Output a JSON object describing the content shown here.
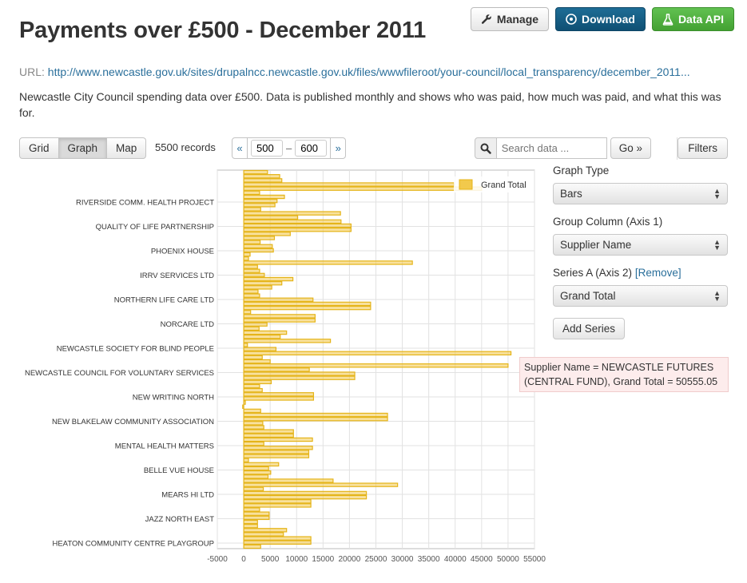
{
  "page": {
    "title": "Payments over £500 - December 2011",
    "url_label": "URL:",
    "url": "http://www.newcastle.gov.uk/sites/drupalncc.newcastle.gov.uk/files/wwwfileroot/your-council/local_transparency/december_2011...",
    "description": "Newcastle City Council spending data over £500. Data is published monthly and shows who was paid, how much was paid, and what this was for."
  },
  "actions": {
    "manage": "Manage",
    "download": "Download",
    "data_api": "Data API"
  },
  "toolbar": {
    "views": [
      "Grid",
      "Graph",
      "Map"
    ],
    "active_view": "Graph",
    "records": "5500 records",
    "prev": "«",
    "next": "»",
    "range_from": "500",
    "range_to": "600",
    "range_sep": "–",
    "search_placeholder": "Search data ...",
    "go": "Go »",
    "filters": "Filters"
  },
  "side": {
    "graph_type_label": "Graph Type",
    "graph_type_value": "Bars",
    "group_column_label": "Group Column (Axis 1)",
    "group_column_value": "Supplier Name",
    "series_a_label": "Series A (Axis 2)",
    "remove_link": "[Remove]",
    "series_a_value": "Grand Total",
    "add_series": "Add Series"
  },
  "tooltip": {
    "text": "Supplier Name = NEWCASTLE FUTURES (CENTRAL FUND), Grand Total = 50555.05"
  },
  "colors": {
    "bar_fill": "#f2c94c",
    "bar_stroke": "#e5b419",
    "primary": "#155e87",
    "success": "#4fb33d",
    "link": "#2a6f9b",
    "tooltip_bg": "#fdecec"
  },
  "chart_data": {
    "type": "bar",
    "orientation": "horizontal",
    "legend": [
      "Grand Total"
    ],
    "legend_position": "top-right",
    "grid": true,
    "xlim": [
      -5000,
      55000
    ],
    "xticks": [
      -5000,
      0,
      5000,
      10000,
      15000,
      20000,
      25000,
      30000,
      35000,
      40000,
      45000,
      50000,
      55000
    ],
    "category_labels": [
      "RIVERSIDE COMM. HEALTH PROJECT",
      "QUALITY OF LIFE PARTNERSHIP",
      "PHOENIX HOUSE",
      "IRRV SERVICES LTD",
      "NORTHERN LIFE CARE LTD",
      "NORCARE LTD",
      "NEWCASTLE SOCIETY FOR BLIND PEOPLE",
      "NEWCASTLE COUNCIL FOR VOLUNTARY SERVICES",
      "NEW WRITING NORTH",
      "NEW BLAKELAW COMMUNITY ASSOCIATION",
      "MENTAL HEALTH MATTERS",
      "BELLE VUE HOUSE",
      "MEARS HI LTD",
      "JAZZ NORTH EAST",
      "HEATON COMMUNITY CENTRE PLAYGROUP"
    ],
    "series": [
      {
        "name": "Grand Total",
        "values": [
          4500,
          6800,
          7200,
          39800,
          45000,
          3000,
          7700,
          6300,
          5900,
          3200,
          18300,
          10200,
          18400,
          20300,
          20300,
          8800,
          5800,
          3100,
          5400,
          5600,
          1200,
          900,
          31900,
          2600,
          3000,
          3900,
          9300,
          7200,
          5300,
          2700,
          3000,
          13100,
          24000,
          24000,
          1300,
          13500,
          13500,
          4400,
          2900,
          8100,
          6900,
          16400,
          700,
          6100,
          50555,
          3500,
          5000,
          50000,
          12400,
          21000,
          21000,
          5200,
          3000,
          3500,
          13200,
          13200,
          300,
          -200,
          3200,
          27200,
          27200,
          3600,
          3800,
          9400,
          9400,
          13000,
          3800,
          13000,
          12300,
          12300,
          900,
          6600,
          4700,
          5100,
          4600,
          16900,
          29100,
          3700,
          23200,
          23200,
          12700,
          12700,
          3000,
          4800,
          4800,
          2600,
          2600,
          8100,
          7500,
          12700,
          12700,
          3200
        ]
      }
    ]
  }
}
